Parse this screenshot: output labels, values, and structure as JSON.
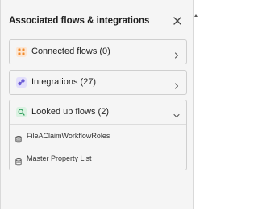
{
  "panel": {
    "title": "Associated flows & integrations",
    "close_icon": "close-icon"
  },
  "sections": [
    {
      "label": "Connected flows (0)",
      "icon": "connected-flows-icon",
      "icon_color": "#f08a2c",
      "expanded": false
    },
    {
      "label": "Integrations (27)",
      "icon": "integrations-icon",
      "icon_color": "#6b5cd6",
      "expanded": false
    },
    {
      "label": "Looked up flows (2)",
      "icon": "lookup-flows-icon",
      "icon_color": "#2e9e5b",
      "expanded": true,
      "items": [
        {
          "label": "FileAClaimWorkflowRoles",
          "icon": "database-icon"
        },
        {
          "label": "Master Property List",
          "icon": "database-icon"
        }
      ]
    }
  ]
}
